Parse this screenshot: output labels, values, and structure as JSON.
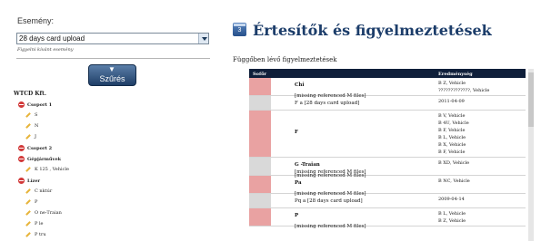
{
  "sidebar": {
    "event_label": "Esemény:",
    "event_select_value": "28 days card upload",
    "event_hint": "Figyelni kívánt esemény",
    "filter_label": "Szűrés",
    "tree_title": "WTCD Kft.",
    "tree": [
      {
        "label": "Csoport 1",
        "type": "group"
      },
      {
        "label": "S",
        "type": "item"
      },
      {
        "label": "N",
        "type": "item"
      },
      {
        "label": "J",
        "type": "item"
      },
      {
        "label": "Csoport 2",
        "type": "group"
      },
      {
        "label": "Gépjárművek",
        "type": "group"
      },
      {
        "label": "K 125 , Vehicle",
        "type": "item"
      },
      {
        "label": "Lízer",
        "type": "group"
      },
      {
        "label": "C   nktúr",
        "type": "item"
      },
      {
        "label": "P",
        "type": "item"
      },
      {
        "label": "O   ne-Traian",
        "type": "item"
      },
      {
        "label": "P   le",
        "type": "item"
      },
      {
        "label": "P   tru",
        "type": "item"
      }
    ]
  },
  "main": {
    "title": "Értesítők és figyelmeztetések",
    "title_icon": "calendar-icon",
    "section_title": "Függőben lévő figyelmeztetések",
    "columns": [
      "Sofőr",
      "Eredménység"
    ],
    "rows": [
      {
        "device_lines": [
          "Chi",
          "[missing referenced M files]"
        ],
        "vehicle_lines": [
          "B   Z, Vehicle",
          "?????????????, Vehicle"
        ]
      },
      {
        "device_lines": [
          "F    a [28 days card upload]"
        ],
        "vehicle_lines": [
          "2011-04-09"
        ]
      },
      {
        "device_lines": [
          "F   ",
          "[missing referenced M files]"
        ],
        "vehicle_lines": [
          "B   V, Vehicle",
          "B   4U, Vehicle",
          "B   F, Vehicle",
          "B   L, Vehicle",
          "B   X, Vehicle",
          "B   F, Vehicle"
        ]
      },
      {
        "device_lines": [
          "G   -Traian",
          "[missing referenced M files]"
        ],
        "vehicle_lines": [
          "B   XD, Vehicle"
        ]
      },
      {
        "device_lines": [
          "Pa   ",
          "[missing referenced M files]"
        ],
        "vehicle_lines": [
          "B   NC, Vehicle"
        ]
      },
      {
        "device_lines": [
          "Pq   a [28 days card upload]"
        ],
        "vehicle_lines": [
          "2009-04-14"
        ]
      },
      {
        "device_lines": [
          "P   ",
          "[missing referenced M files]"
        ],
        "vehicle_lines": [
          "B   L, Vehicle",
          "B   Z, Vehicle"
        ]
      }
    ]
  },
  "colors": {
    "header_bg": "#0f1f3a",
    "title": "#1c3d6a",
    "alert_strip": "#e9a2a2"
  }
}
